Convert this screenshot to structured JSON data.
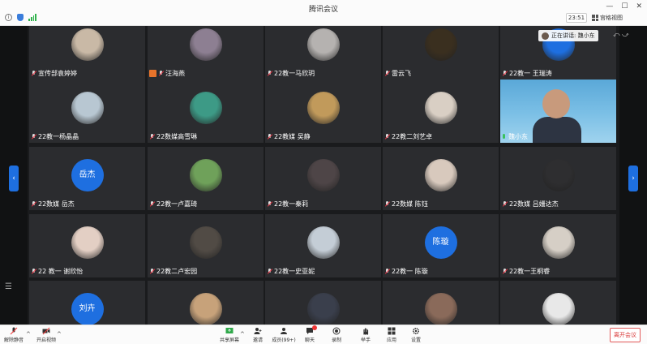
{
  "window": {
    "title": "腾讯会议"
  },
  "status": {
    "time": "23:51",
    "view_label": "宫格视图"
  },
  "speaking": {
    "label": "正在讲话: 魏小东"
  },
  "participants": [
    {
      "name": "宣传部袁婷婷",
      "avatar": "photo",
      "color": "#c9b9a6"
    },
    {
      "name": "汪海燕",
      "avatar": "photo",
      "color": "#8d7f92",
      "sharing": true
    },
    {
      "name": "22教一马欣玥",
      "avatar": "photo",
      "color": "#b5b2b0"
    },
    {
      "name": "雷云飞",
      "avatar": "photo",
      "color": "#3a2f1f"
    },
    {
      "name": "22教一 王瑞涛",
      "avatar": "photo",
      "color": "#1e6fe0"
    },
    {
      "name": "22教一杨晶晶",
      "avatar": "photo",
      "color": "#b8c7d2"
    },
    {
      "name": "22数媒高雪琳",
      "avatar": "photo",
      "color": "#3d9a86"
    },
    {
      "name": "22教媒 吴静",
      "avatar": "photo",
      "color": "#c19a5b"
    },
    {
      "name": "22教二刘艺卓",
      "avatar": "photo",
      "color": "#d9cfc4"
    },
    {
      "name": "魏小东",
      "avatar": "video",
      "color": "#5aa8d8",
      "mic_on": true
    },
    {
      "name": "22数媒 岳杰",
      "avatar": "text",
      "initials": "岳杰",
      "color": "#1e6fe0"
    },
    {
      "name": "22教一卢嘉琦",
      "avatar": "photo",
      "color": "#6fa15a"
    },
    {
      "name": "22教一秦莉",
      "avatar": "photo",
      "color": "#4e4547"
    },
    {
      "name": "22数媒 陈钰",
      "avatar": "photo",
      "color": "#d8c9bd"
    },
    {
      "name": "22数媒 吕姗达杰",
      "avatar": "photo",
      "color": "#2e2e30"
    },
    {
      "name": "22 教一 谢欣怡",
      "avatar": "photo",
      "color": "#e3cfc4"
    },
    {
      "name": "22教二卢宏园",
      "avatar": "photo",
      "color": "#514b45"
    },
    {
      "name": "22教一史亚妮",
      "avatar": "photo",
      "color": "#c4cdd6"
    },
    {
      "name": "22教一 陈璇",
      "avatar": "text",
      "initials": "陈璇",
      "color": "#1e6fe0"
    },
    {
      "name": "22教一王桐睿",
      "avatar": "photo",
      "color": "#d6cfc6"
    },
    {
      "name": "刘卉",
      "avatar": "text",
      "initials": "刘卉",
      "color": "#1e6fe0"
    },
    {
      "name": "",
      "avatar": "photo",
      "color": "#c7a27a"
    },
    {
      "name": "",
      "avatar": "photo",
      "color": "#3a3f4c"
    },
    {
      "name": "",
      "avatar": "photo",
      "color": "#8a6a5a"
    },
    {
      "name": "",
      "avatar": "photo",
      "color": "#e8e8e8"
    }
  ],
  "toolbar": {
    "unmute": "解除静音",
    "video": "开启视频",
    "share": "共享屏幕",
    "invite": "邀请",
    "members": "成员(99+)",
    "chat": "聊天",
    "record": "录制",
    "raise_hand": "举手",
    "apps": "应用",
    "settings": "设置",
    "leave": "离开会议"
  }
}
